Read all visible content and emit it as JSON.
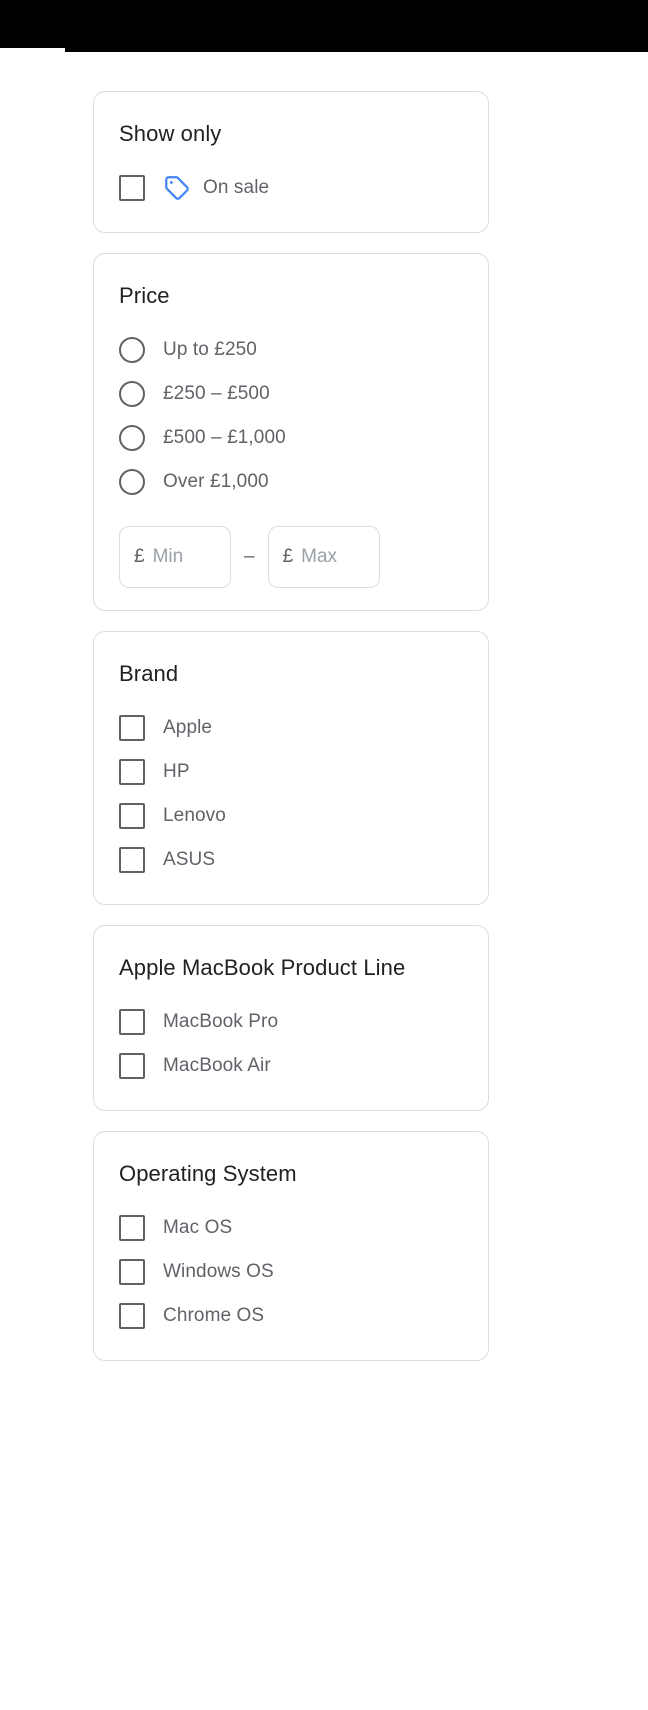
{
  "colors": {
    "accent_blue": "#4285f4",
    "card_border": "#dadce0",
    "title_text": "#202124",
    "option_text": "#5f6368",
    "placeholder_text": "#9aa0a6",
    "chrome_bar": "#000000"
  },
  "sections": [
    {
      "id": "show-only",
      "title": "Show only",
      "control": "checkbox",
      "options": [
        {
          "label": "On sale",
          "icon": "price-tag-icon",
          "checked": false
        }
      ]
    },
    {
      "id": "price",
      "title": "Price",
      "control": "radio",
      "options": [
        {
          "label": "Up to £250",
          "checked": false
        },
        {
          "label": "£250 – £500",
          "checked": false
        },
        {
          "label": "£500 – £1,000",
          "checked": false
        },
        {
          "label": "Over £1,000",
          "checked": false
        }
      ],
      "range": {
        "currency_symbol": "£",
        "min_value": "",
        "min_placeholder": "Min",
        "separator": "–",
        "max_value": "",
        "max_placeholder": "Max"
      }
    },
    {
      "id": "brand",
      "title": "Brand",
      "control": "checkbox",
      "options": [
        {
          "label": "Apple",
          "checked": false
        },
        {
          "label": "HP",
          "checked": false
        },
        {
          "label": "Lenovo",
          "checked": false
        },
        {
          "label": "ASUS",
          "checked": false
        }
      ]
    },
    {
      "id": "macbook-product-line",
      "title": "Apple MacBook Product Line",
      "control": "checkbox",
      "options": [
        {
          "label": "MacBook Pro",
          "checked": false
        },
        {
          "label": "MacBook Air",
          "checked": false
        }
      ]
    },
    {
      "id": "operating-system",
      "title": "Operating System",
      "control": "checkbox",
      "options": [
        {
          "label": "Mac OS",
          "checked": false
        },
        {
          "label": "Windows OS",
          "checked": false
        },
        {
          "label": "Chrome OS",
          "checked": false
        }
      ]
    }
  ]
}
